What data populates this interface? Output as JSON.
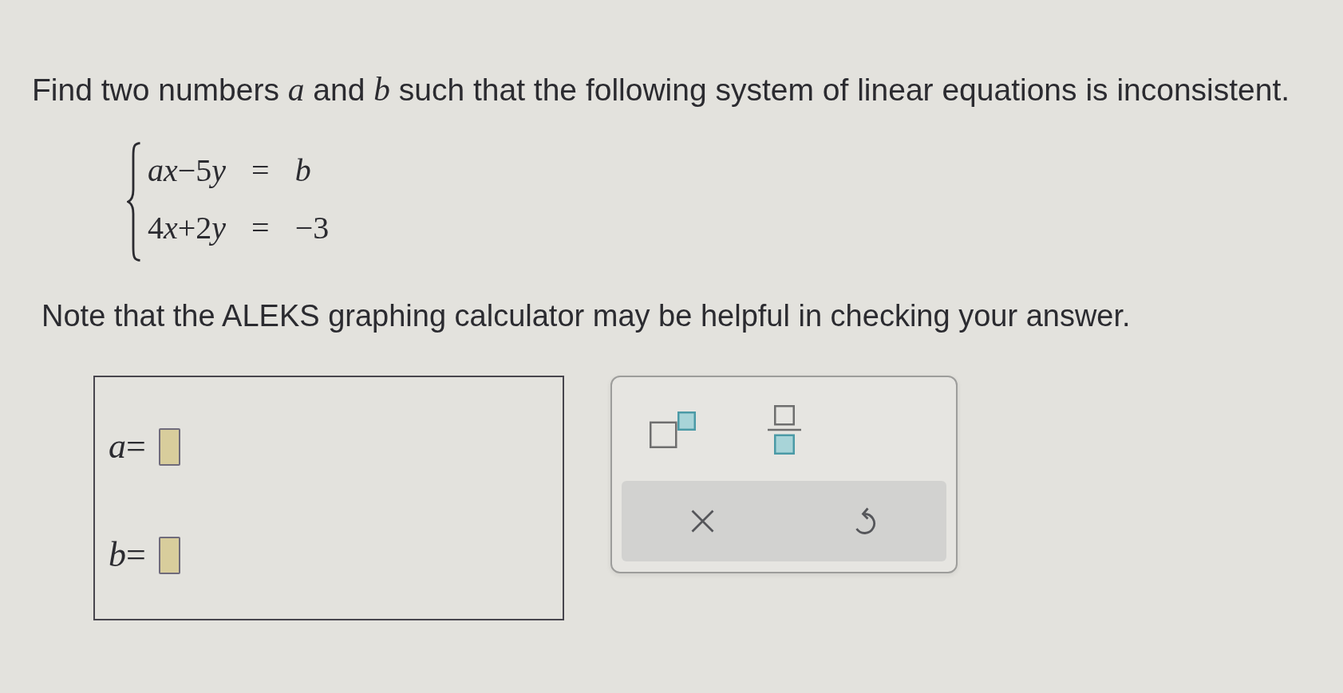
{
  "question": "Find two numbers *a* and *b* such that the following system of linear equations is inconsistent.",
  "system": [
    {
      "text": "ax−5y = b"
    },
    {
      "text": "4x+2y = −3"
    }
  ],
  "note": "Note that the ALEKS graphing calculator may be helpful in checking your answer.",
  "answers": [
    {
      "label": "a="
    },
    {
      "label": "b="
    }
  ],
  "toolbar": {
    "templates": [
      {
        "kind": "superscript"
      },
      {
        "kind": "fraction"
      }
    ],
    "actions": [
      {
        "kind": "clear"
      },
      {
        "kind": "undo"
      }
    ]
  }
}
